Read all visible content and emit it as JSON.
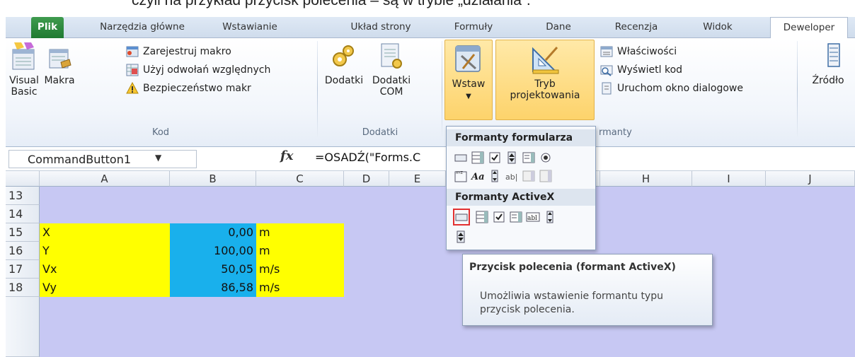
{
  "caption": "czyli na przykład przycisk polecenia – są w trybie „działania”.",
  "tabs": [
    {
      "label": "Plik"
    },
    {
      "label": "Narzędzia główne"
    },
    {
      "label": "Wstawianie"
    },
    {
      "label": "Układ strony"
    },
    {
      "label": "Formuły"
    },
    {
      "label": "Dane"
    },
    {
      "label": "Recenzja"
    },
    {
      "label": "Widok"
    },
    {
      "label": "Deweloper"
    }
  ],
  "ribbon": {
    "kod": {
      "visual_basic_1": "Visual",
      "visual_basic_2": "Basic",
      "makra": "Makra",
      "record": "Zarejestruj makro",
      "relative": "Użyj odwołań względnych",
      "security": "Bezpieczeństwo makr",
      "group": "Kod"
    },
    "dodatki": {
      "dodatki": "Dodatki",
      "com_1": "Dodatki",
      "com_2": "COM",
      "group": "Dodatki"
    },
    "formanty": {
      "wstaw": "Wstaw",
      "tryb_1": "Tryb",
      "tryb_2": "projektowania",
      "properties": "Właściwości",
      "view_code": "Wyświetl kod",
      "run_dialog": "Uruchom okno dialogowe",
      "group": "rmanty"
    },
    "xml": {
      "zrodlo": "Źródło"
    }
  },
  "formula_bar": {
    "name_box": "CommandButton1",
    "fx": "fx",
    "formula_left": "=OSADŹ(\"Forms.C",
    "formula_right": "\"\")"
  },
  "columns": [
    {
      "label": "A"
    },
    {
      "label": "B"
    },
    {
      "label": "C"
    },
    {
      "label": "D"
    },
    {
      "label": "E"
    },
    {
      "label": "H"
    },
    {
      "label": "I"
    },
    {
      "label": "J"
    }
  ],
  "rows": [
    {
      "num": "13"
    },
    {
      "num": "14"
    },
    {
      "num": "15"
    },
    {
      "num": "16"
    },
    {
      "num": "17"
    },
    {
      "num": "18"
    }
  ],
  "cells": [
    {
      "row": 15,
      "name": "X",
      "value": "0,00",
      "unit": "m"
    },
    {
      "row": 16,
      "name": "Y",
      "value": "100,00",
      "unit": "m"
    },
    {
      "row": 17,
      "name": "Vx",
      "value": "50,05",
      "unit": "m/s"
    },
    {
      "row": 18,
      "name": "Vy",
      "value": "86,58",
      "unit": "m/s"
    }
  ],
  "dropdown": {
    "form_controls_title": "Formanty formularza",
    "activex_title": "Formanty ActiveX"
  },
  "tooltip": {
    "title": "Przycisk polecenia (formant ActiveX)",
    "description": "Umożliwia wstawienie formantu typu przycisk polecenia."
  },
  "colors": {
    "highlight": "#fdd36b",
    "sheet_bg": "#c7c8f3",
    "yellow": "#ffff00",
    "cyan": "#19b0ec",
    "file_tab": "#2a8a3b"
  }
}
